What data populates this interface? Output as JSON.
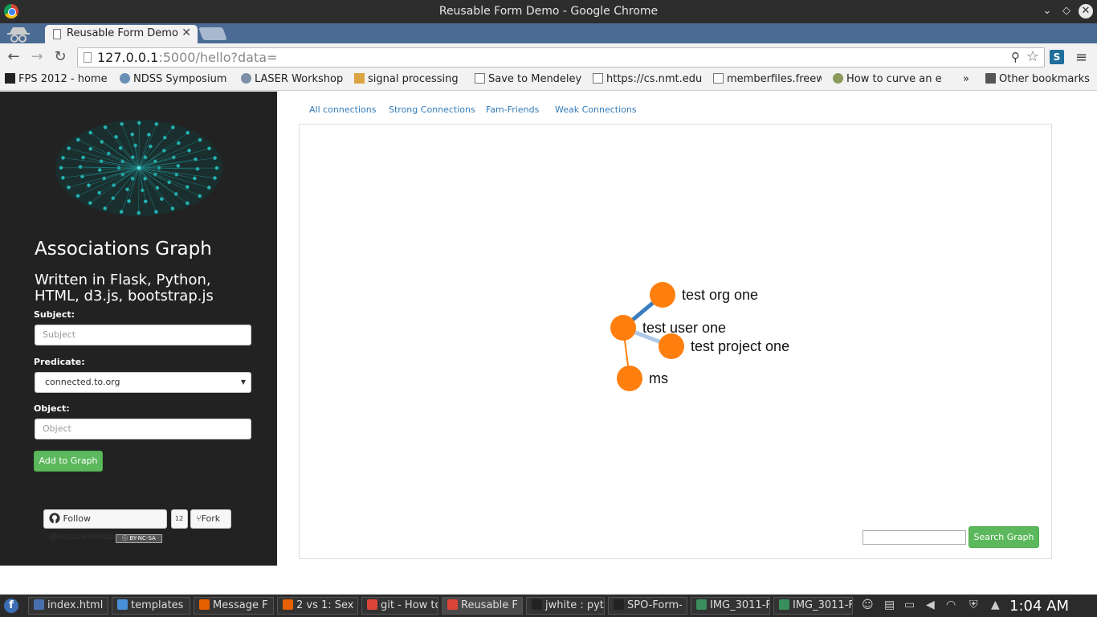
{
  "window": {
    "title": "Reusable Form Demo - Google Chrome"
  },
  "tab": {
    "label": "Reusable Form Demo"
  },
  "address_bar": {
    "host": "127.0.0.1",
    "rest": ":5000/hello?data="
  },
  "bookmarks": [
    {
      "label": "FPS 2012 - home",
      "icon": "terminal-icon"
    },
    {
      "label": "NDSS Symposium",
      "icon": "globe-icon"
    },
    {
      "label": "LASER Workshop",
      "icon": "cert-icon"
    },
    {
      "label": "signal processing",
      "icon": "sp-icon"
    },
    {
      "label": "Save to Mendeley",
      "icon": "page-icon"
    },
    {
      "label": "https://cs.nmt.edu",
      "icon": "page-icon"
    },
    {
      "label": "memberfiles.freew",
      "icon": "page-icon"
    },
    {
      "label": "How to curve an e",
      "icon": "leaf-icon"
    }
  ],
  "bookmarks_overflow": "»",
  "other_bookmarks": "Other bookmarks",
  "sidebar": {
    "title": "Associations Graph",
    "subtitle": "Written in Flask, Python, HTML, d3.js, bootstrap.js",
    "subject_label": "Subject:",
    "subject_placeholder": "Subject",
    "predicate_label": "Predicate:",
    "predicate_value": "connected.to.org",
    "object_label": "Object:",
    "object_placeholder": "Object",
    "add_button": "Add to Graph",
    "follow_label": "Follow @securemindorg",
    "follow_count": "12",
    "fork_label": "Fork",
    "license": "BY-NC-SA"
  },
  "main": {
    "tabs": [
      "All connections",
      "Strong Connections",
      "Fam-Friends",
      "Weak Connections"
    ],
    "graph": {
      "nodes": [
        {
          "id": "org",
          "label": "test org one"
        },
        {
          "id": "user",
          "label": "test user one"
        },
        {
          "id": "project",
          "label": "test project one"
        },
        {
          "id": "ms",
          "label": "ms"
        }
      ],
      "links": [
        {
          "source": "user",
          "target": "org",
          "color": "#3a7dbf"
        },
        {
          "source": "user",
          "target": "project",
          "color": "#aec7e8"
        },
        {
          "source": "user",
          "target": "ms",
          "color": "#ff7f0e"
        }
      ],
      "node_color": "#ff7f0e"
    },
    "search_button": "Search Graph"
  },
  "taskbar": {
    "tasks": [
      {
        "label": "index.html",
        "icon": "file-icon"
      },
      {
        "label": "templates",
        "icon": "mail-icon"
      },
      {
        "label": "Message F",
        "icon": "firefox-icon"
      },
      {
        "label": "2 vs 1: Sex",
        "icon": "firefox-icon"
      },
      {
        "label": "git - How to",
        "icon": "chrome-icon"
      },
      {
        "label": "Reusable F",
        "icon": "chrome-icon"
      },
      {
        "label": "jwhite : pyt",
        "icon": "terminal-icon"
      },
      {
        "label": "SPO-Form-",
        "icon": "terminal-icon"
      },
      {
        "label": "IMG_3011-F",
        "icon": "image-icon"
      },
      {
        "label": "IMG_3011-F",
        "icon": "image-icon"
      }
    ],
    "clock": "1:04 AM"
  },
  "colors": {
    "accent": "#5cb85c",
    "link": "#337ab7",
    "sidebar_bg": "#222222"
  }
}
